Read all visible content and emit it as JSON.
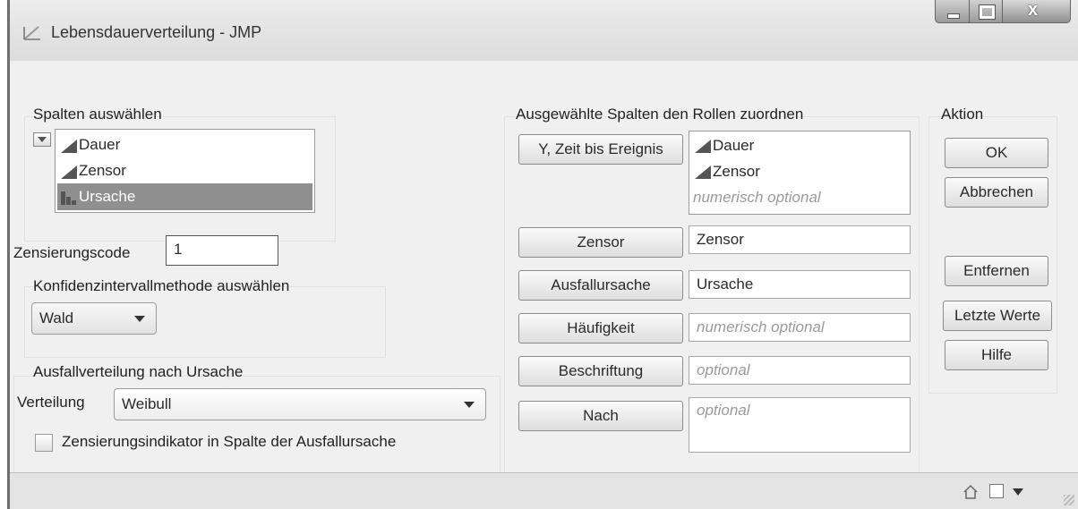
{
  "window": {
    "title": "Lebensdauerverteilung - JMP",
    "controls": [
      "minimize-icon",
      "maximize-icon",
      "close-icon"
    ]
  },
  "select_columns": {
    "label": "Spalten auswählen",
    "items": [
      {
        "label": "Dauer",
        "icon": "continuous-icon",
        "selected": false
      },
      {
        "label": "Zensor",
        "icon": "continuous-icon",
        "selected": false
      },
      {
        "label": "Ursache",
        "icon": "nominal-icon",
        "selected": true
      }
    ]
  },
  "censor_code": {
    "label": "Zensierungscode",
    "value": "1"
  },
  "ci_method": {
    "label": "Konfidenzintervallmethode auswählen",
    "value": "Wald"
  },
  "failure_dist": {
    "label": "Ausfallverteilung nach Ursache",
    "dist_label": "Verteilung",
    "dist_value": "Weibull",
    "checkbox_label": "Zensierungsindikator in Spalte der Ausfallursache",
    "checked": false
  },
  "roles": {
    "label": "Ausgewählte Spalten den Rollen zuordnen",
    "y_button": "Y, Zeit bis Ereignis",
    "y_items": [
      "Dauer",
      "Zensor"
    ],
    "y_placeholder": "numerisch optional",
    "censor_button": "Zensor",
    "censor_value": "Zensor",
    "cause_button": "Ausfallursache",
    "cause_value": "Ursache",
    "freq_button": "Häufigkeit",
    "freq_placeholder": "numerisch optional",
    "label_button": "Beschriftung",
    "label_placeholder": "optional",
    "by_button": "Nach",
    "by_placeholder": "optional"
  },
  "action": {
    "label": "Aktion",
    "ok": "OK",
    "cancel": "Abbrechen",
    "remove": "Entfernen",
    "recall": "Letzte Werte",
    "help": "Hilfe"
  },
  "status_icons": [
    "home-icon",
    "window-icon",
    "menu-caret-icon"
  ]
}
